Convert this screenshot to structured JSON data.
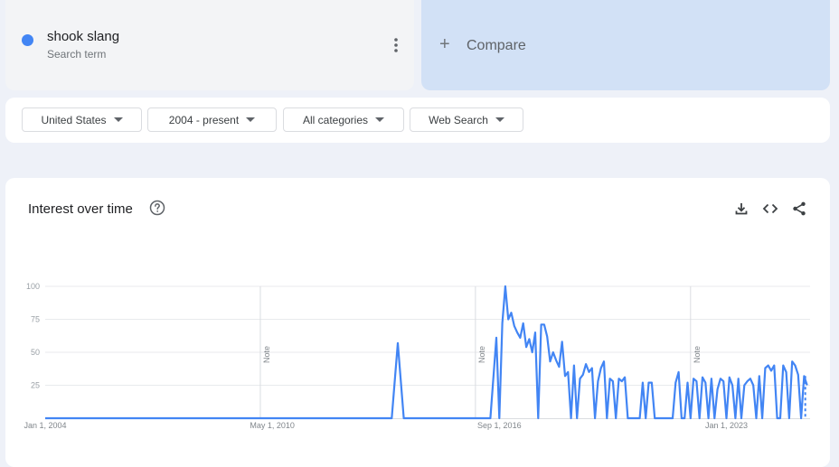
{
  "search_term": {
    "name": "shook slang",
    "type": "Search term",
    "color": "#4285f4"
  },
  "compare": {
    "label": "Compare"
  },
  "filters": {
    "region": "United States",
    "time": "2004 - present",
    "category": "All categories",
    "property": "Web Search"
  },
  "interest": {
    "title": "Interest over time"
  },
  "chart_data": {
    "type": "line",
    "color": "#4285f4",
    "ylim": [
      0,
      100
    ],
    "yticks": [
      "25",
      "50",
      "75",
      "100"
    ],
    "xtick_labels": [
      "Jan 1, 2004",
      "May 1, 2010",
      "Sep 1, 2016",
      "Jan 1, 2023"
    ],
    "notes": [
      {
        "date": "2010-01",
        "label": "Note"
      },
      {
        "date": "2016-01",
        "label": "Note"
      },
      {
        "date": "2022-01",
        "label": "Note"
      }
    ],
    "series": [
      {
        "values": [
          [
            "2004-01",
            0
          ],
          [
            "2013-09",
            0
          ],
          [
            "2013-11",
            57
          ],
          [
            "2014-01",
            0
          ],
          [
            "2016-06",
            0
          ],
          [
            "2016-08",
            61
          ],
          [
            "2016-09",
            0
          ],
          [
            "2016-10",
            72
          ],
          [
            "2016-11",
            100
          ],
          [
            "2016-12",
            75
          ],
          [
            "2017-01",
            80
          ],
          [
            "2017-02",
            70
          ],
          [
            "2017-03",
            65
          ],
          [
            "2017-04",
            61
          ],
          [
            "2017-05",
            72
          ],
          [
            "2017-06",
            54
          ],
          [
            "2017-07",
            60
          ],
          [
            "2017-08",
            50
          ],
          [
            "2017-09",
            65
          ],
          [
            "2017-10",
            0
          ],
          [
            "2017-11",
            71
          ],
          [
            "2017-12",
            71
          ],
          [
            "2018-01",
            62
          ],
          [
            "2018-02",
            43
          ],
          [
            "2018-03",
            50
          ],
          [
            "2018-04",
            44
          ],
          [
            "2018-05",
            39
          ],
          [
            "2018-06",
            58
          ],
          [
            "2018-07",
            32
          ],
          [
            "2018-08",
            35
          ],
          [
            "2018-09",
            0
          ],
          [
            "2018-10",
            40
          ],
          [
            "2018-11",
            0
          ],
          [
            "2018-12",
            30
          ],
          [
            "2019-01",
            33
          ],
          [
            "2019-02",
            41
          ],
          [
            "2019-03",
            35
          ],
          [
            "2019-04",
            38
          ],
          [
            "2019-05",
            0
          ],
          [
            "2019-06",
            28
          ],
          [
            "2019-07",
            38
          ],
          [
            "2019-08",
            43
          ],
          [
            "2019-09",
            0
          ],
          [
            "2019-10",
            30
          ],
          [
            "2019-11",
            28
          ],
          [
            "2019-12",
            0
          ],
          [
            "2020-01",
            30
          ],
          [
            "2020-02",
            28
          ],
          [
            "2020-03",
            31
          ],
          [
            "2020-04",
            0
          ],
          [
            "2020-05",
            0
          ],
          [
            "2020-06",
            0
          ],
          [
            "2020-07",
            0
          ],
          [
            "2020-08",
            0
          ],
          [
            "2020-09",
            27
          ],
          [
            "2020-10",
            0
          ],
          [
            "2020-11",
            27
          ],
          [
            "2020-12",
            27
          ],
          [
            "2021-01",
            0
          ],
          [
            "2021-02",
            0
          ],
          [
            "2021-03",
            0
          ],
          [
            "2021-04",
            0
          ],
          [
            "2021-05",
            0
          ],
          [
            "2021-06",
            0
          ],
          [
            "2021-07",
            0
          ],
          [
            "2021-08",
            27
          ],
          [
            "2021-09",
            35
          ],
          [
            "2021-10",
            0
          ],
          [
            "2021-11",
            0
          ],
          [
            "2021-12",
            27
          ],
          [
            "2022-01",
            0
          ],
          [
            "2022-02",
            30
          ],
          [
            "2022-03",
            28
          ],
          [
            "2022-04",
            0
          ],
          [
            "2022-05",
            31
          ],
          [
            "2022-06",
            27
          ],
          [
            "2022-07",
            0
          ],
          [
            "2022-08",
            30
          ],
          [
            "2022-09",
            0
          ],
          [
            "2022-10",
            22
          ],
          [
            "2022-11",
            30
          ],
          [
            "2022-12",
            28
          ],
          [
            "2023-01",
            0
          ],
          [
            "2023-02",
            31
          ],
          [
            "2023-03",
            25
          ],
          [
            "2023-04",
            0
          ],
          [
            "2023-05",
            30
          ],
          [
            "2023-06",
            0
          ],
          [
            "2023-07",
            25
          ],
          [
            "2023-08",
            28
          ],
          [
            "2023-09",
            30
          ],
          [
            "2023-10",
            25
          ],
          [
            "2023-11",
            0
          ],
          [
            "2023-12",
            32
          ],
          [
            "2024-01",
            0
          ],
          [
            "2024-02",
            38
          ],
          [
            "2024-03",
            40
          ],
          [
            "2024-04",
            36
          ],
          [
            "2024-05",
            40
          ],
          [
            "2024-06",
            0
          ],
          [
            "2024-07",
            0
          ],
          [
            "2024-08",
            40
          ],
          [
            "2024-09",
            35
          ],
          [
            "2024-10",
            0
          ],
          [
            "2024-11",
            43
          ],
          [
            "2024-12",
            40
          ],
          [
            "2025-01",
            33
          ],
          [
            "2025-02",
            0
          ],
          [
            "2025-03",
            32
          ],
          [
            "2025-04",
            25
          ]
        ]
      }
    ]
  }
}
